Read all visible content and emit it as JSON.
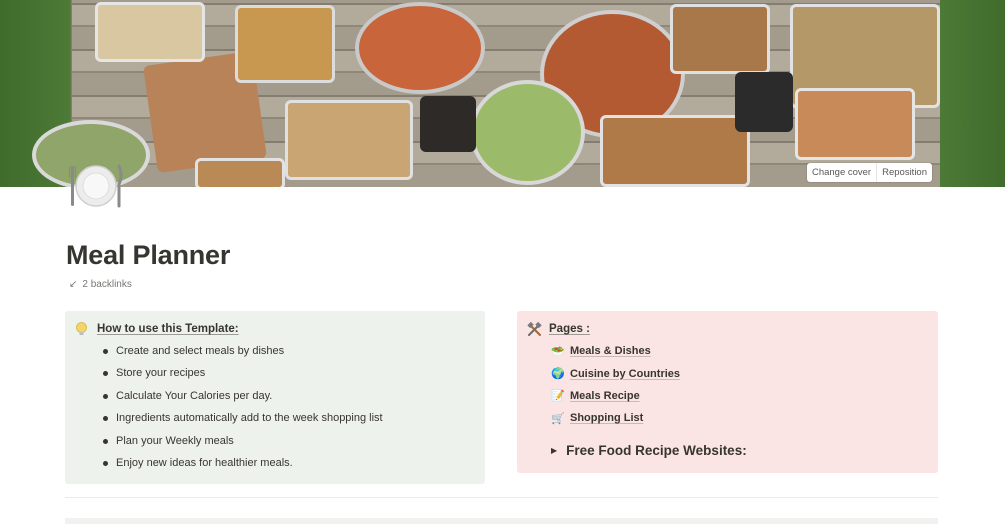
{
  "cover": {
    "change_cover_label": "Change cover",
    "reposition_label": "Reposition"
  },
  "page": {
    "icon": "dinner-plate-icon",
    "title": "Meal Planner",
    "backlinks_label": "2 backlinks"
  },
  "how_to": {
    "icon": "lightbulb-icon",
    "heading": "How to use this Template:",
    "items": [
      "Create and select meals by dishes",
      "Store your recipes",
      "Calculate Your Calories per day.",
      "Ingredients automatically add to the week shopping list",
      "Plan your Weekly meals",
      "Enjoy new ideas for healthier meals."
    ]
  },
  "pages": {
    "icon": "tools-icon",
    "heading": "Pages :",
    "items": [
      {
        "icon": "bowl-icon",
        "glyph": "🥗",
        "label": "Meals & Dishes"
      },
      {
        "icon": "globe-icon",
        "glyph": "🌍",
        "label": "Cuisine by Countries"
      },
      {
        "icon": "memo-icon",
        "glyph": "📝",
        "label": "Meals Recipe"
      },
      {
        "icon": "cart-icon",
        "glyph": "🛒",
        "label": "Shopping List"
      }
    ],
    "toggle_label": "Free Food Recipe Websites:"
  },
  "colors": {
    "callout_green": "#edf3ec",
    "callout_red": "#fbe4e4",
    "text": "#37352f",
    "muted": "#787774"
  }
}
